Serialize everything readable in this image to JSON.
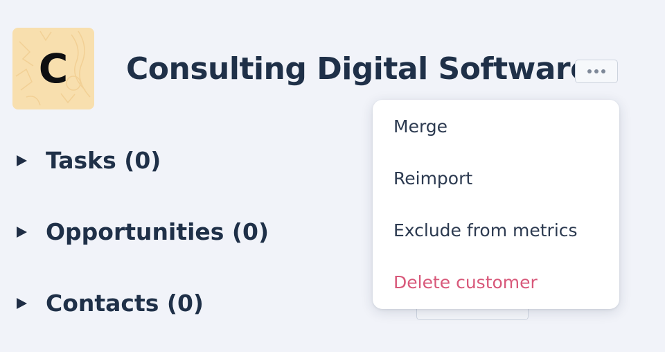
{
  "header": {
    "avatar_letter": "C",
    "title": "Consulting Digital Software",
    "more_icon": "ellipsis-icon"
  },
  "sections": [
    {
      "label": "Tasks (0)",
      "icon": "caret-right-icon"
    },
    {
      "label": "Opportunities (0)",
      "icon": "caret-right-icon"
    },
    {
      "label": "Contacts (0)",
      "icon": "caret-right-icon"
    }
  ],
  "menu": {
    "items": [
      {
        "label": "Merge"
      },
      {
        "label": "Reimport"
      },
      {
        "label": "Exclude from metrics"
      },
      {
        "label": "Delete customer"
      }
    ]
  },
  "colors": {
    "background": "#f1f3f9",
    "avatar_bg": "#f8dfae",
    "text": "#1f3048",
    "danger": "#d8587a"
  }
}
